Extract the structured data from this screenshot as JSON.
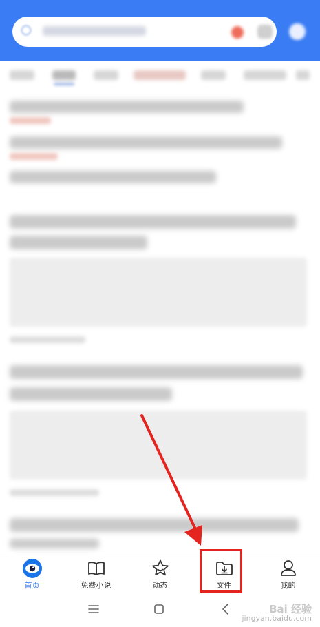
{
  "nav": {
    "items": [
      {
        "label": "首页",
        "icon": "home-eye-icon",
        "active": true
      },
      {
        "label": "免费小说",
        "icon": "book-icon",
        "active": false
      },
      {
        "label": "动态",
        "icon": "star-icon",
        "active": false
      },
      {
        "label": "文件",
        "icon": "folder-download-icon",
        "active": false
      },
      {
        "label": "我的",
        "icon": "person-icon",
        "active": false
      }
    ]
  },
  "colors": {
    "brand_blue": "#3a7cf4",
    "highlight_red": "#e3241f"
  },
  "watermark": {
    "logo": "Bai 经验",
    "url": "jingyan.baidu.com"
  }
}
